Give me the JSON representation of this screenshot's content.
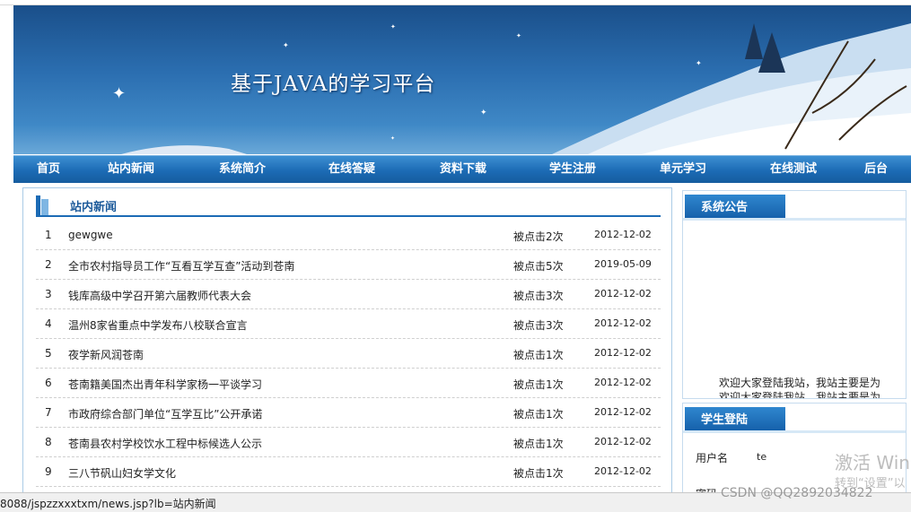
{
  "banner": {
    "title": "基于JAVA的学习平台"
  },
  "nav": [
    "首页",
    "站内新闻",
    "系统简介",
    "在线答疑",
    "资料下载",
    "学生注册",
    "单元学习",
    "在线测试",
    "后台"
  ],
  "news": {
    "heading": "站内新闻",
    "rows": [
      {
        "num": "1",
        "title": "gewgwe",
        "clicks": "被点击2次",
        "date": "2012-12-02"
      },
      {
        "num": "2",
        "title": "全市农村指导员工作“互看互学互查”活动到苍南",
        "clicks": "被点击5次",
        "date": "2019-05-09"
      },
      {
        "num": "3",
        "title": "钱库高级中学召开第六届教师代表大会",
        "clicks": "被点击3次",
        "date": "2012-12-02"
      },
      {
        "num": "4",
        "title": "温州8家省重点中学发布八校联合宣言",
        "clicks": "被点击3次",
        "date": "2012-12-02"
      },
      {
        "num": "5",
        "title": "夜学新风润苍南",
        "clicks": "被点击1次",
        "date": "2012-12-02"
      },
      {
        "num": "6",
        "title": "苍南籍美国杰出青年科学家杨一平谈学习",
        "clicks": "被点击1次",
        "date": "2012-12-02"
      },
      {
        "num": "7",
        "title": "市政府综合部门单位“互学互比”公开承诺",
        "clicks": "被点击1次",
        "date": "2012-12-02"
      },
      {
        "num": "8",
        "title": "苍南县农村学校饮水工程中标候选人公示",
        "clicks": "被点击1次",
        "date": "2012-12-02"
      },
      {
        "num": "9",
        "title": "三八节矾山妇女学文化",
        "clicks": "被点击1次",
        "date": "2012-12-02"
      }
    ]
  },
  "notice": {
    "title": "系统公告",
    "text": "欢迎大家登陆我站，我站主要是为",
    "text2": "欢迎大家登陆我站，我站主要是为"
  },
  "login": {
    "title": "学生登陆",
    "username_label": "用户名",
    "username_value": "te",
    "password_label": "密码"
  },
  "statusbar": {
    "url": "8088/jspzzxxxtxm/news.jsp?lb=站内新闻"
  },
  "watermark": {
    "line1": "激活 Win",
    "line2": "转到“设置”以",
    "csdn": "CSDN @QQ2892034822"
  }
}
